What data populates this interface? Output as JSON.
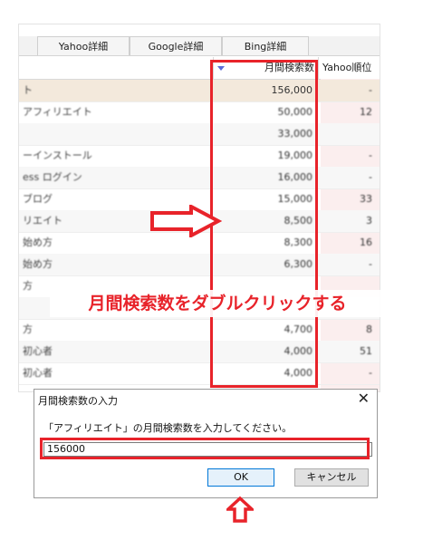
{
  "tabs": [
    "Yahoo詳細",
    "Google詳細",
    "Bing詳細"
  ],
  "columns": {
    "volume": "月間検索数",
    "yahoo_rank": "Yahoo順位"
  },
  "rows": [
    {
      "keyword": "ト",
      "volume": "156,000",
      "rank": "-"
    },
    {
      "keyword": "アフィリエイト",
      "volume": "50,000",
      "rank": "12"
    },
    {
      "keyword": "",
      "volume": "33,000",
      "rank": ""
    },
    {
      "keyword": "ーインストール",
      "volume": "19,000",
      "rank": "-"
    },
    {
      "keyword": "ess ログイン",
      "volume": "16,000",
      "rank": "-"
    },
    {
      "keyword": "ブログ",
      "volume": "15,000",
      "rank": "33"
    },
    {
      "keyword": "リエイト",
      "volume": "8,500",
      "rank": "3"
    },
    {
      "keyword": "始め方",
      "volume": "8,300",
      "rank": "16"
    },
    {
      "keyword": "始め方",
      "volume": "6,300",
      "rank": "-"
    },
    {
      "keyword": "方",
      "volume": "",
      "rank": ""
    },
    {
      "keyword": "",
      "volume": "",
      "rank": ""
    },
    {
      "keyword": "方",
      "volume": "4,700",
      "rank": "8"
    },
    {
      "keyword": "初心者",
      "volume": "4,000",
      "rank": "51"
    },
    {
      "keyword": "初心者",
      "volume": "4,000",
      "rank": "-"
    }
  ],
  "caption": "月間検索数をダブルクリックする",
  "dialog": {
    "title": "月間検索数の入力",
    "close": "✕",
    "prompt": "「アフィリエイト」の月間検索数を入力してください。",
    "input_value": "156000",
    "ok_label": "OK",
    "cancel_label": "キャンセル"
  },
  "colors": {
    "highlight": "#e8232a",
    "sort_arrow": "#5a6bd8",
    "selected_row": "#f3e9dc",
    "rank_column": "#fbeeee"
  },
  "icons": [
    "sort-desc-icon",
    "right-arrow-annotation-icon",
    "up-arrow-annotation-icon"
  ]
}
